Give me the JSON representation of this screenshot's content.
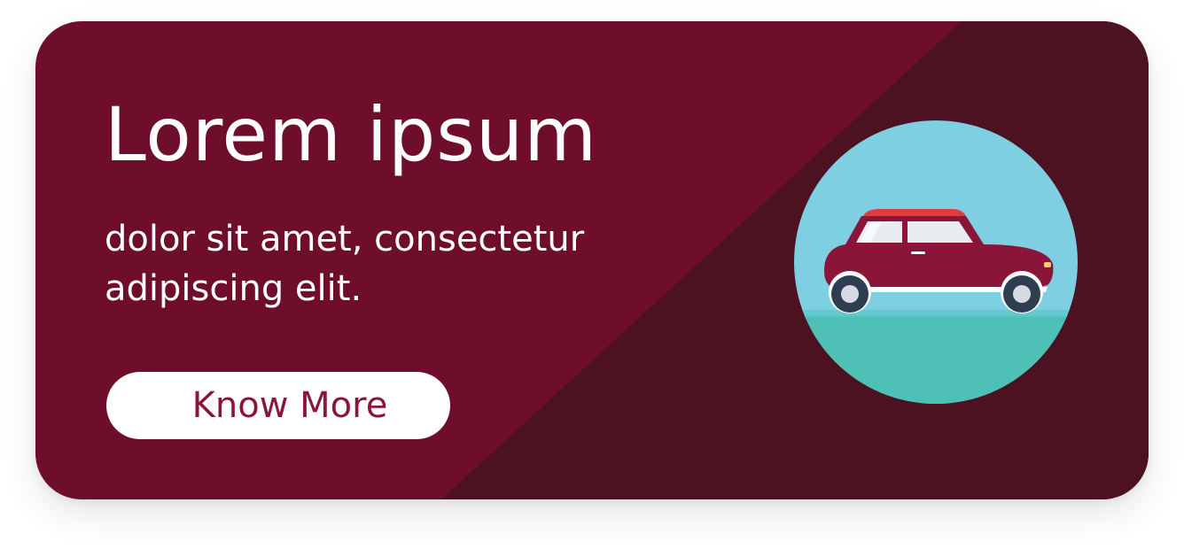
{
  "banner": {
    "title": "Lorem ipsum",
    "subtitle": "dolor sit amet, consectetur adipiscing elit.",
    "button_label": "Know More"
  },
  "colors": {
    "card_background": "#6e0e2a",
    "diagonal_shade": "#4c1221",
    "text": "#ffffff",
    "button_background": "#ffffff",
    "button_text": "#8a1538",
    "sky": "#7ecfe2",
    "ground": "#4fc0b6",
    "car_body": "#8a1538",
    "car_roof": "#e23b3b",
    "tire": "#2e3e50",
    "hubcap": "#d6dbe3"
  },
  "icons": {
    "illustration": "car-icon"
  }
}
